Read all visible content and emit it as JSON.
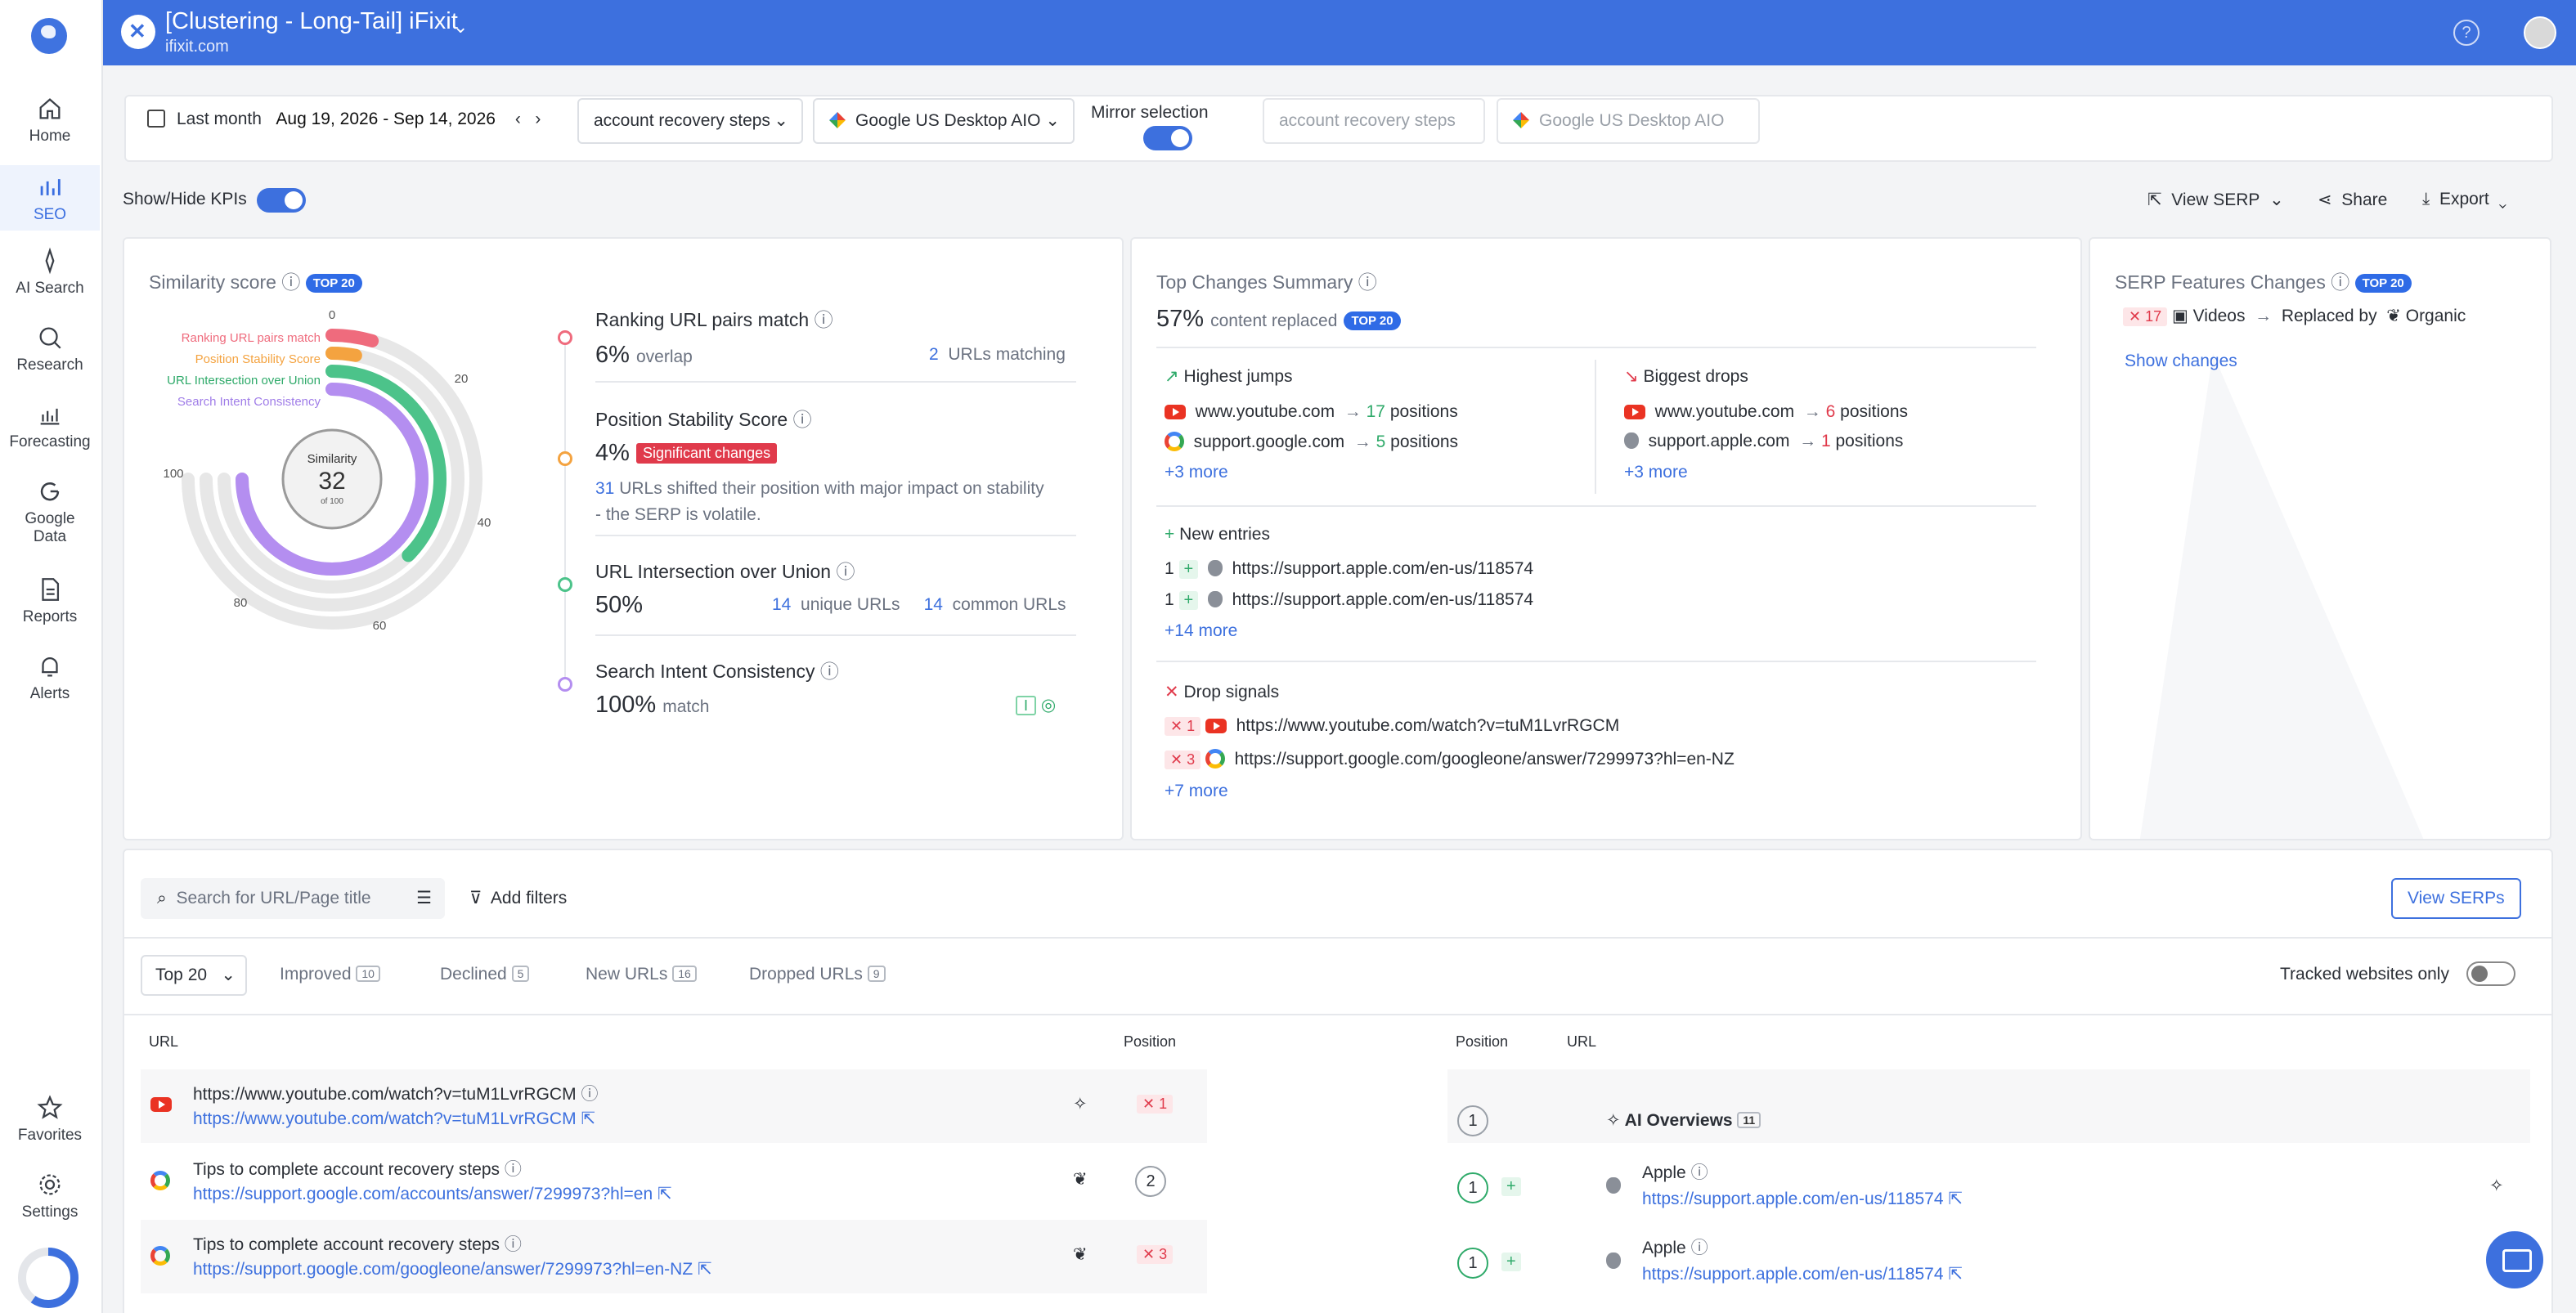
{
  "sidebar": {
    "items": [
      {
        "label": "Home",
        "icon": "home-icon"
      },
      {
        "label": "SEO",
        "icon": "bar-chart-icon"
      },
      {
        "label": "AI Search",
        "icon": "sparkle-icon"
      },
      {
        "label": "Research",
        "icon": "magnify-icon"
      },
      {
        "label": "Forecasting",
        "icon": "forecast-icon"
      },
      {
        "label": "Google Data",
        "icon": "google-icon"
      },
      {
        "label": "Reports",
        "icon": "report-icon"
      },
      {
        "label": "Alerts",
        "icon": "bell-icon"
      },
      {
        "label": "Favorites",
        "icon": "star-icon"
      },
      {
        "label": "Settings",
        "icon": "gear-icon"
      }
    ]
  },
  "header": {
    "project_title": "[Clustering - Long-Tail] iFixit",
    "project_domain": "ifixit.com",
    "help_label": "?"
  },
  "filters": {
    "date_preset": "Last month",
    "date_range": "Aug 19, 2026 - Sep 14, 2026",
    "keyword": "account recovery steps",
    "engine": "Google US Desktop AIO",
    "mirror_label": "Mirror selection",
    "mirror_on": true,
    "mirror_keyword": "account recovery steps",
    "mirror_engine": "Google US Desktop AIO"
  },
  "kpi_bar": {
    "show_hide_label": "Show/Hide KPIs",
    "view_serp": "View SERP",
    "share": "Share",
    "export": "Export"
  },
  "similarity": {
    "title": "Similarity score",
    "badge": "TOP 20",
    "center_label": "Similarity",
    "center_value": "32",
    "center_sub": "of 100",
    "legend": [
      "Ranking URL pairs match",
      "Position Stability Score",
      "URL Intersection over Union",
      "Search Intent Consistency"
    ],
    "legend_colors": [
      "#ef6b7d",
      "#f4a340",
      "#4cc38a",
      "#b48ef0"
    ],
    "ring_values": [
      6,
      4,
      50,
      100
    ],
    "ticks": [
      "0",
      "20",
      "40",
      "60",
      "80",
      "100"
    ],
    "metrics": [
      {
        "title": "Ranking URL pairs match",
        "value": "6%",
        "unit": "overlap",
        "extra_num": "2",
        "extra_text": "URLs matching"
      },
      {
        "title": "Position Stability Score",
        "value": "4%",
        "flag": "Significant changes",
        "desc_num": "31",
        "desc": "URLs shifted their position with major impact on stability - the SERP is volatile."
      },
      {
        "title": "URL Intersection over Union",
        "value": "50%",
        "n1": "14",
        "t1": "unique URLs",
        "n2": "14",
        "t2": "common URLs"
      },
      {
        "title": "Search Intent Consistency",
        "value": "100%",
        "unit": "match",
        "intent": "I"
      }
    ]
  },
  "top_changes": {
    "title": "Top Changes Summary",
    "pct": "57%",
    "pct_label": "content replaced",
    "badge": "TOP 20",
    "jumps_title": "Highest jumps",
    "jumps": [
      {
        "site": "www.youtube.com",
        "num": "17",
        "unit": "positions",
        "favicon": "youtube"
      },
      {
        "site": "support.google.com",
        "num": "5",
        "unit": "positions",
        "favicon": "google"
      }
    ],
    "jumps_more": "+3 more",
    "drops_title": "Biggest drops",
    "drops": [
      {
        "site": "www.youtube.com",
        "num": "6",
        "unit": "positions",
        "favicon": "youtube"
      },
      {
        "site": "support.apple.com",
        "num": "1",
        "unit": "positions",
        "favicon": "apple"
      }
    ],
    "drops_more": "+3 more",
    "new_title": "New entries",
    "new_entries": [
      {
        "pos": "1",
        "url": "https://support.apple.com/en-us/118574"
      },
      {
        "pos": "1",
        "url": "https://support.apple.com/en-us/118574"
      }
    ],
    "new_more": "+14 more",
    "drop_title": "Drop signals",
    "drop_signals": [
      {
        "pos": "1",
        "url": "https://www.youtube.com/watch?v=tuM1LvrRGCM"
      },
      {
        "pos": "3",
        "url": "https://support.google.com/googleone/answer/7299973?hl=en-NZ"
      }
    ],
    "drop_more": "+7 more"
  },
  "serp_features": {
    "title": "SERP Features Changes",
    "badge": "TOP 20",
    "x_count": "17",
    "feature": "Videos",
    "replaced_by": "Replaced by",
    "replacement": "Organic",
    "show_changes": "Show changes"
  },
  "table_toolbar": {
    "search_placeholder": "Search for URL/Page title",
    "add_filters": "Add filters",
    "view_serps": "View SERPs",
    "top_select": "Top 20",
    "tabs": [
      {
        "label": "Improved",
        "count": "10"
      },
      {
        "label": "Declined",
        "count": "5"
      },
      {
        "label": "New URLs",
        "count": "16"
      },
      {
        "label": "Dropped URLs",
        "count": "9"
      }
    ],
    "tracked_only": "Tracked websites only"
  },
  "left_table": {
    "col_url": "URL",
    "col_position": "Position",
    "rows": [
      {
        "title": "https://www.youtube.com/watch?v=tuM1LvrRGCM",
        "url": "https://www.youtube.com/watch?v=tuM1LvrRGCM",
        "position": "1",
        "dropped": true,
        "favicon": "youtube"
      },
      {
        "title": "Tips to complete account recovery steps",
        "url": "https://support.google.com/accounts/answer/7299973?hl=en",
        "position": "2",
        "dropped": false,
        "favicon": "google"
      },
      {
        "title": "Tips to complete account recovery steps",
        "url": "https://support.google.com/googleone/answer/7299973?hl=en-NZ",
        "position": "3",
        "dropped": true,
        "favicon": "google"
      }
    ]
  },
  "right_table": {
    "col_position": "Position",
    "col_url": "URL",
    "ai_overview": {
      "position": "1",
      "label": "AI Overviews",
      "count": "11"
    },
    "rows": [
      {
        "position": "1",
        "title": "Apple",
        "url": "https://support.apple.com/en-us/118574",
        "new": true
      },
      {
        "position": "1",
        "title": "Apple",
        "url": "https://support.apple.com/en-us/118574",
        "new": true
      }
    ]
  }
}
